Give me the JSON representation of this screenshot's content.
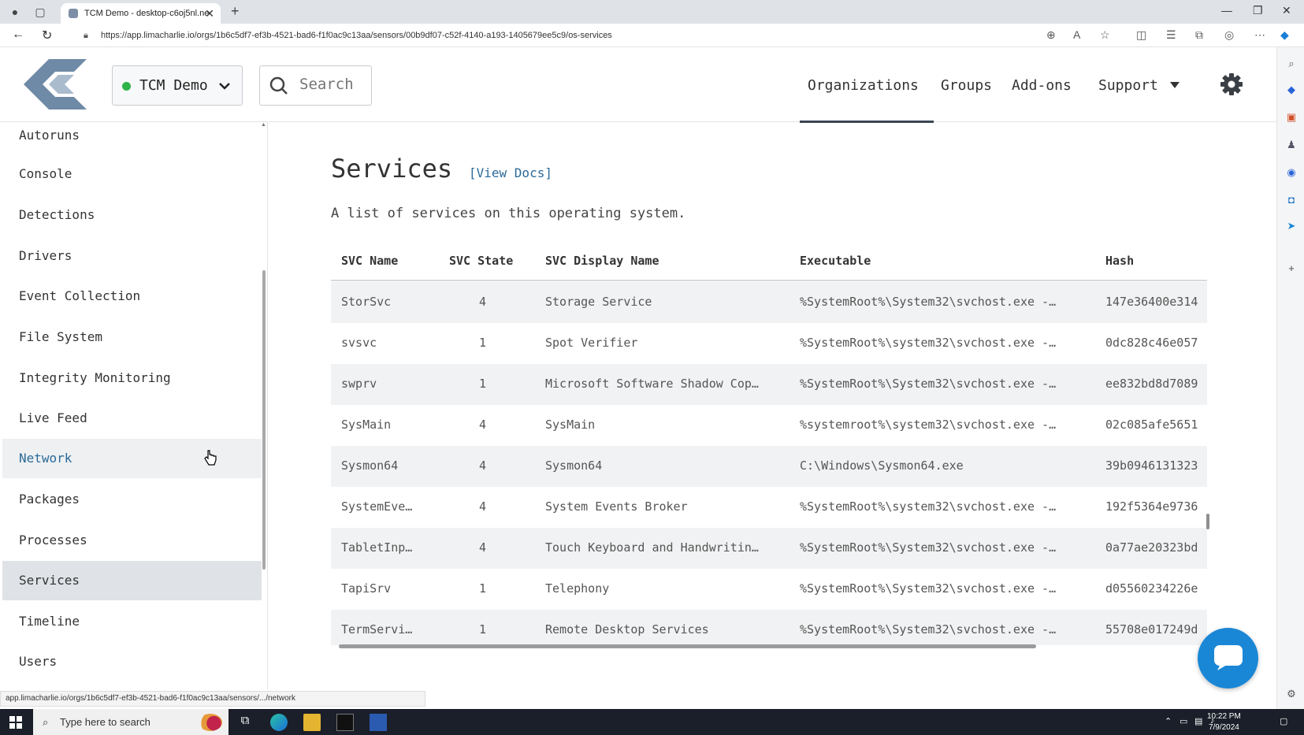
{
  "browser": {
    "tab_title": "TCM Demo - desktop-c6oj5nl.ne",
    "url": "https://app.limacharlie.io/orgs/1b6c5df7-ef3b-4521-bad6-f1f0ac9c13aa/sensors/00b9df07-c52f-4140-a193-1405679ee5c9/os-services",
    "status_url": "app.limacharlie.io/orgs/1b6c5df7-ef3b-4521-bad6-f1f0ac9c13aa/sensors/.../network"
  },
  "header": {
    "org_name": "TCM Demo",
    "search_placeholder": "Search",
    "nav": [
      "Organizations",
      "Groups",
      "Add-ons",
      "Support"
    ]
  },
  "sidebar": {
    "items": [
      "Autoruns",
      "Console",
      "Detections",
      "Drivers",
      "Event Collection",
      "File System",
      "Integrity Monitoring",
      "Live Feed",
      "Network",
      "Packages",
      "Processes",
      "Services",
      "Timeline",
      "Users"
    ],
    "hovered": "Network",
    "active": "Services"
  },
  "main": {
    "title": "Services",
    "view_docs": "[View Docs]",
    "description": "A list of services on this operating system."
  },
  "table": {
    "columns": [
      "SVC Name",
      "SVC State",
      "SVC Display Name",
      "Executable",
      "Hash"
    ],
    "rows": [
      [
        "StorSvc",
        "4",
        "Storage Service",
        "%SystemRoot%\\System32\\svchost.exe -…",
        "147e36400e314"
      ],
      [
        "svsvc",
        "1",
        "Spot Verifier",
        "%SystemRoot%\\system32\\svchost.exe -…",
        "0dc828c46e057"
      ],
      [
        "swprv",
        "1",
        "Microsoft Software Shadow Cop…",
        "%SystemRoot%\\System32\\svchost.exe -…",
        "ee832bd8d7089"
      ],
      [
        "SysMain",
        "4",
        "SysMain",
        "%systemroot%\\system32\\svchost.exe -…",
        "02c085afe5651"
      ],
      [
        "Sysmon64",
        "4",
        "Sysmon64",
        "C:\\Windows\\Sysmon64.exe",
        "39b0946131323"
      ],
      [
        "SystemEve…",
        "4",
        "System Events Broker",
        "%SystemRoot%\\system32\\svchost.exe -…",
        "192f5364e9736"
      ],
      [
        "TabletInp…",
        "4",
        "Touch Keyboard and Handwritin…",
        "%SystemRoot%\\System32\\svchost.exe -…",
        "0a77ae20323bd"
      ],
      [
        "TapiSrv",
        "1",
        "Telephony",
        "%SystemRoot%\\System32\\svchost.exe -…",
        "d05560234226e"
      ],
      [
        "TermServi…",
        "1",
        "Remote Desktop Services",
        "%SystemRoot%\\System32\\svchost.exe -…",
        "55708e017249d"
      ]
    ]
  },
  "taskbar": {
    "search_placeholder": "Type here to search",
    "time": "10:22 PM",
    "date": "7/9/2024"
  },
  "colors": {
    "accent_link": "#2b6a99",
    "status_online": "#2fb34a",
    "chat_button": "#1a87d6",
    "taskbar": "#1b1f2a"
  }
}
